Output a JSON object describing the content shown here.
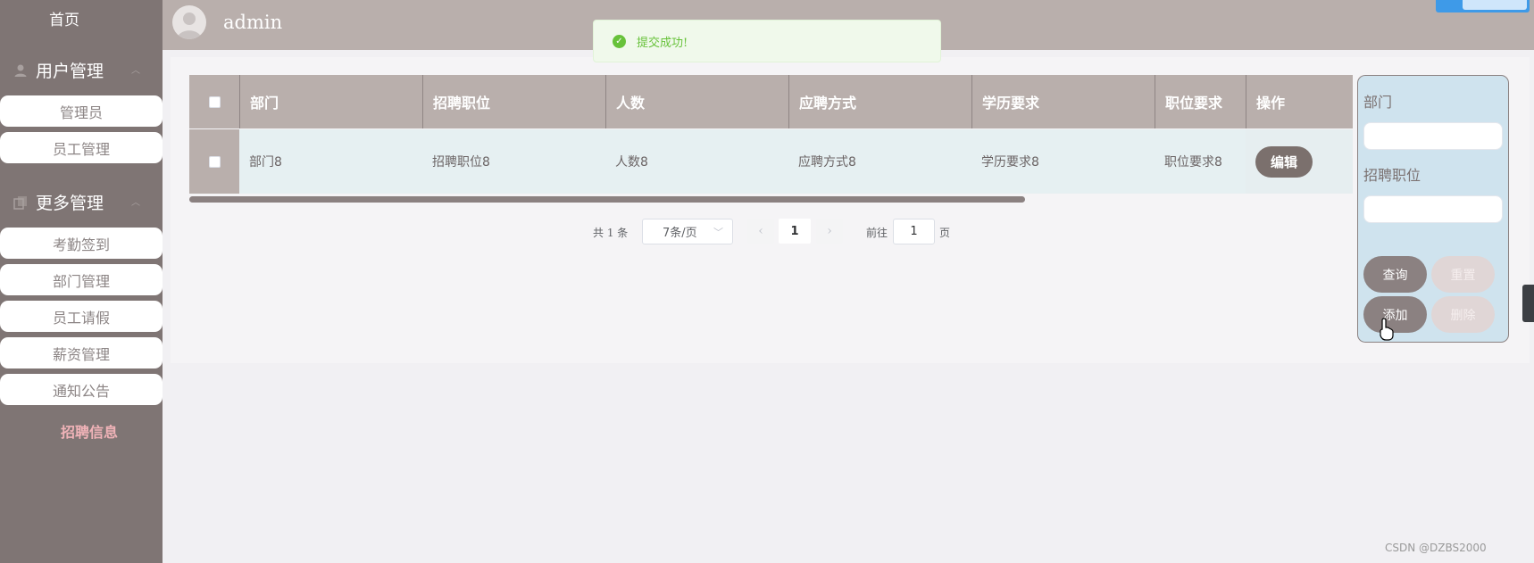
{
  "sidebar": {
    "home": "首页",
    "groups": [
      {
        "label": "用户管理",
        "icon": "user-icon",
        "items": [
          "管理员",
          "员工管理"
        ]
      },
      {
        "label": "更多管理",
        "icon": "copy-icon",
        "items": [
          "考勤签到",
          "部门管理",
          "员工请假",
          "薪资管理",
          "通知公告"
        ]
      }
    ],
    "active_item": "招聘信息"
  },
  "header": {
    "username": "admin"
  },
  "toast": {
    "message": "提交成功!"
  },
  "table": {
    "columns": [
      "部门",
      "招聘职位",
      "人数",
      "应聘方式",
      "学历要求",
      "职位要求",
      "操作"
    ],
    "rows": [
      {
        "cells": [
          "部门8",
          "招聘职位8",
          "人数8",
          "应聘方式8",
          "学历要求8",
          "职位要求8"
        ],
        "action": "编辑"
      }
    ]
  },
  "pagination": {
    "total": "共 1 条",
    "page_size": "7条/页",
    "current_page": "1",
    "goto_label": "前往",
    "goto_value": "1",
    "page_unit": "页"
  },
  "filter": {
    "field1_label": "部门",
    "field2_label": "招聘职位",
    "query_label": "查询",
    "reset_label": "重置",
    "add_label": "添加",
    "delete_label": "删除"
  },
  "watermark": "CSDN @DZBS2000",
  "colors": {
    "sidebar": "#7f7574",
    "header": "#b9afac",
    "row": "#e6f0f2",
    "success": "#67c23a",
    "accent": "#f0b3b8"
  }
}
